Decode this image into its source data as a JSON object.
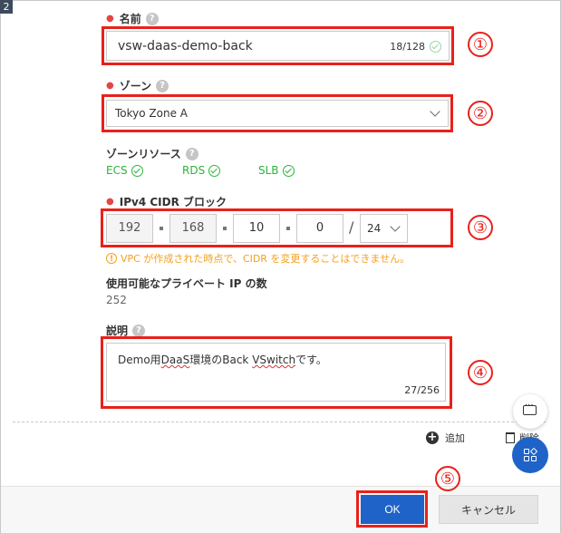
{
  "page_number": "2",
  "name_field": {
    "label": "名前",
    "value": "vsw-daas-demo-back",
    "counter": "18/128"
  },
  "zone_field": {
    "label": "ゾーン",
    "value": "Tokyo Zone A"
  },
  "zone_resources": {
    "label": "ゾーンリソース",
    "items": [
      {
        "label": "ECS"
      },
      {
        "label": "RDS"
      },
      {
        "label": "SLB"
      }
    ]
  },
  "cidr_field": {
    "label": "IPv4 CIDR ブロック",
    "octets": [
      "192",
      "168",
      "10",
      "0"
    ],
    "separator": "/",
    "mask": "24",
    "warning": "VPC が作成された時点で、CIDR を変更することはできません。"
  },
  "available_ips": {
    "label": "使用可能なプライベート IP の数",
    "value": "252"
  },
  "description_field": {
    "label": "説明",
    "value_parts": [
      "Demo用",
      "DaaS",
      "環境のBack ",
      "VSwitch",
      "です。"
    ],
    "counter": "27/256"
  },
  "actions": {
    "add": "追加",
    "delete": "削除"
  },
  "annotations": [
    "①",
    "②",
    "③",
    "④",
    "⑤"
  ],
  "footer": {
    "ok": "OK",
    "cancel": "キャンセル"
  },
  "colors": {
    "primary": "#1f63c8",
    "highlight": "#e8211a",
    "success": "#2db33a",
    "warning": "#f4a01f",
    "required": "#e54545"
  }
}
